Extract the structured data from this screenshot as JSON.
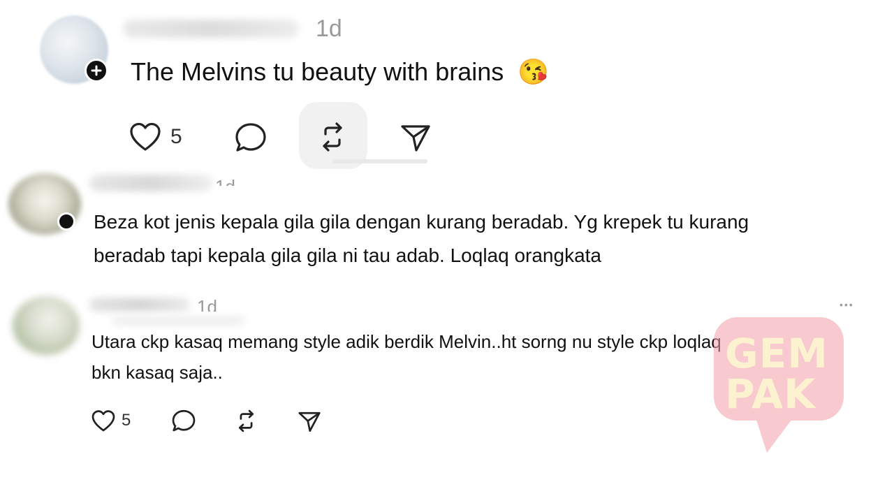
{
  "comments": [
    {
      "timestamp": "1d",
      "text": "The Melvins tu beauty with brains",
      "emoji": "😘",
      "like_count": "5",
      "icons": [
        "heart-icon",
        "comment-icon",
        "repost-icon",
        "share-icon"
      ]
    },
    {
      "timestamp": "1d",
      "lines": [
        "Beza kot jenis kepala gila gila dengan kurang beradab. Yg krepek tu kurang",
        "beradab tapi kepala gila gila ni tau adab. Loqlaq orangkata"
      ]
    },
    {
      "timestamp": "1d",
      "lines": [
        "Utara ckp kasaq memang style adik berdik Melvin..ht sorng nu style ckp loqlaq",
        "bkn kasaq saja.."
      ],
      "like_count": "5",
      "more": "•••"
    }
  ],
  "watermark": {
    "line1": "GEM",
    "line2": "PAK",
    "color": "#f4a0a8",
    "text_color": "#fde8a8"
  },
  "colors": {
    "text": "#111111",
    "muted": "#9a9a9a",
    "icon": "#222222"
  }
}
